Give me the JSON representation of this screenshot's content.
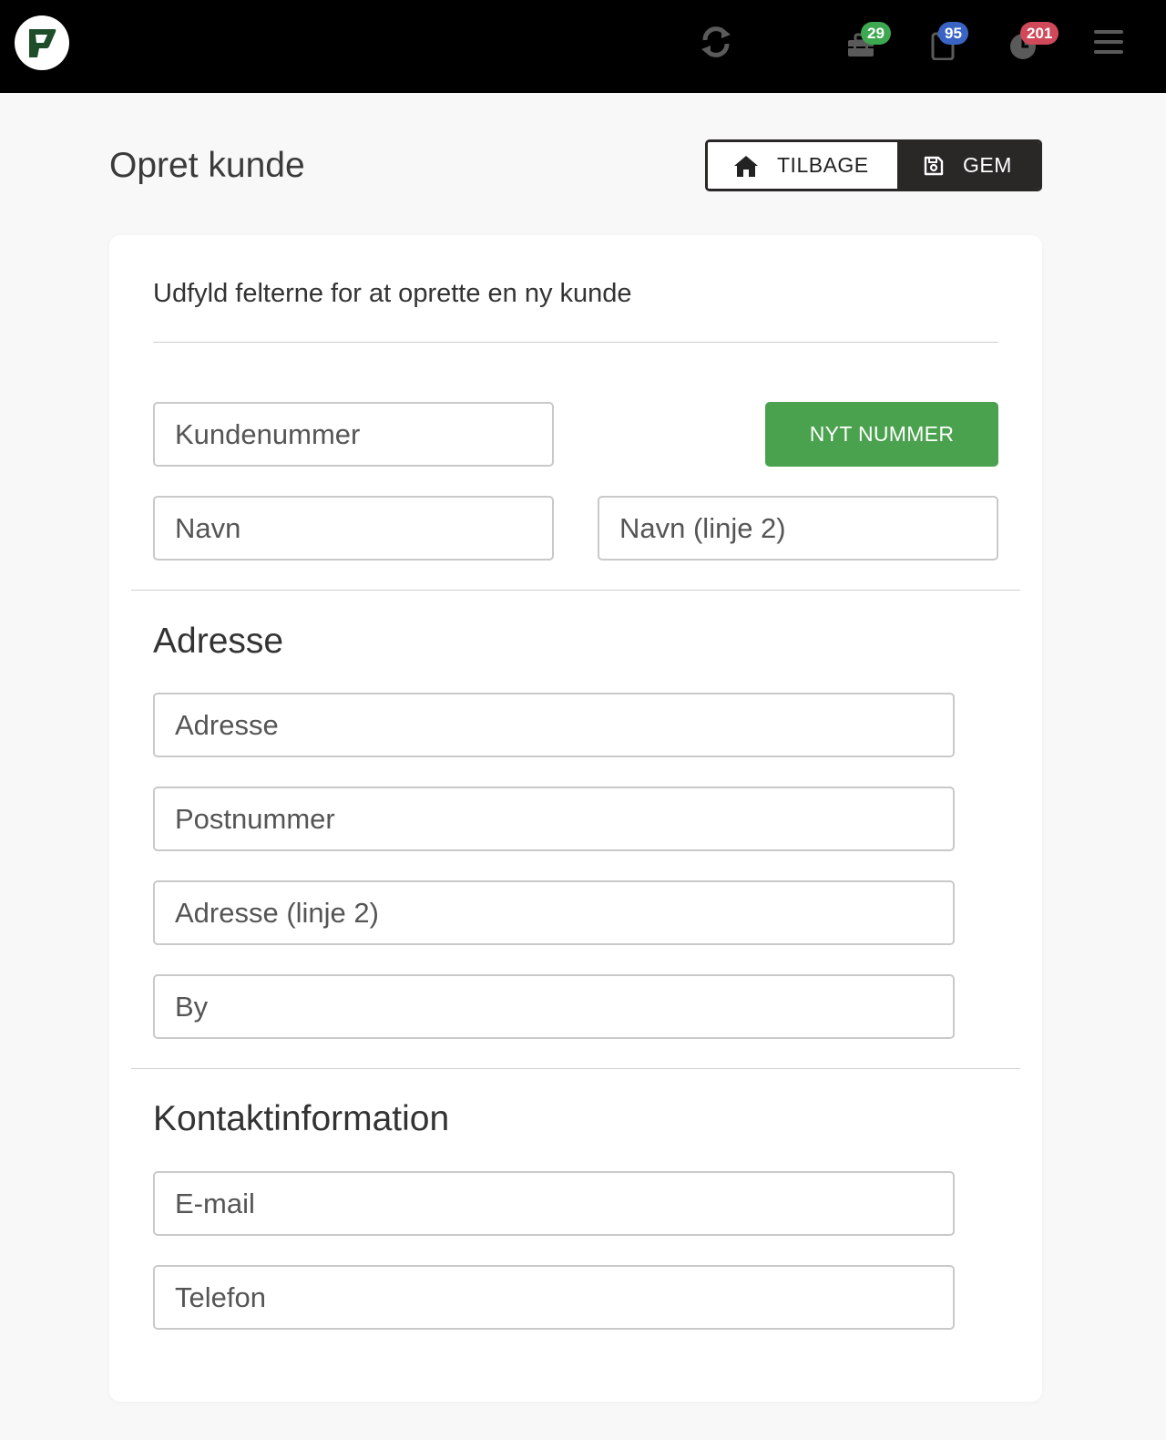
{
  "topbar": {
    "badges": {
      "tasks": "29",
      "documents": "95",
      "time": "201"
    }
  },
  "header": {
    "title": "Opret kunde",
    "back_label": "TILBAGE",
    "save_label": "GEM"
  },
  "form": {
    "intro": "Udfyld felterne for at oprette en ny kunde",
    "customer_number_placeholder": "Kundenummer",
    "new_number_label": "NYT NUMMER",
    "name_placeholder": "Navn",
    "name2_placeholder": "Navn (linje 2)",
    "address_section_title": "Adresse",
    "address_placeholder": "Adresse",
    "postal_placeholder": "Postnummer",
    "address2_placeholder": "Adresse (linje 2)",
    "city_placeholder": "By",
    "contact_section_title": "Kontaktinformation",
    "email_placeholder": "E-mail",
    "phone_placeholder": "Telefon"
  },
  "colors": {
    "accent_green": "#4aa14e",
    "badge_green": "#3ea851",
    "badge_blue": "#3a64c4",
    "badge_red": "#d0495a",
    "dark": "#2a2727"
  }
}
